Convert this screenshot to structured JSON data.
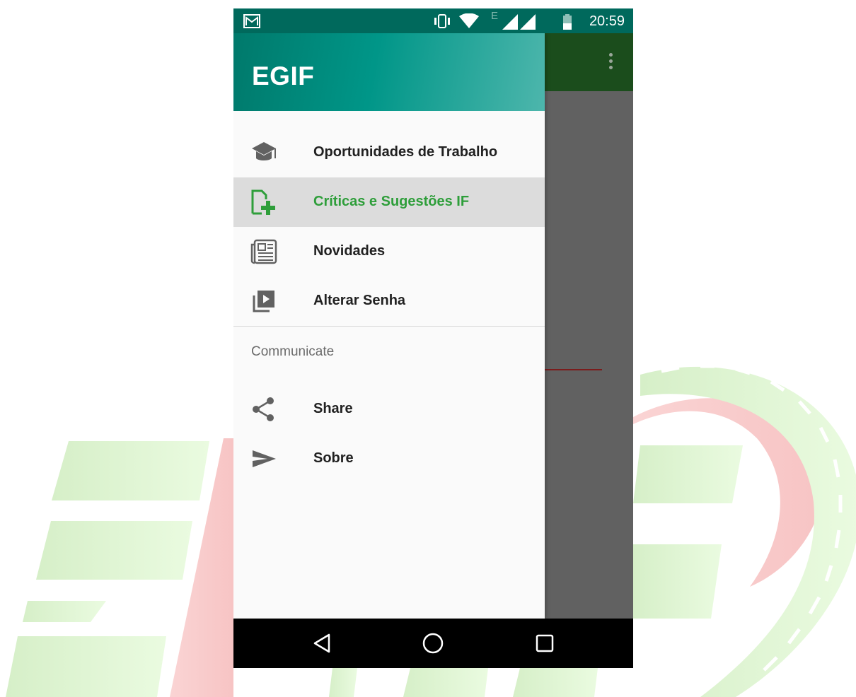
{
  "status_bar": {
    "time": "20:59",
    "network_label": "E",
    "icons": [
      "gmail-icon",
      "vibrate-icon",
      "wifi-icon",
      "signal-icon",
      "signal-icon",
      "battery-icon"
    ]
  },
  "drawer": {
    "title": "EGIF",
    "items": [
      {
        "label": "Oportunidades de Trabalho",
        "icon": "graduation-cap-icon",
        "selected": false
      },
      {
        "label": "Críticas e Sugestões IF",
        "icon": "note-add-icon",
        "selected": true
      },
      {
        "label": "Novidades",
        "icon": "newspaper-icon",
        "selected": false
      },
      {
        "label": "Alterar Senha",
        "icon": "video-library-icon",
        "selected": false
      }
    ],
    "section_header": "Communicate",
    "communicate_items": [
      {
        "label": "Share",
        "icon": "share-icon"
      },
      {
        "label": "Sobre",
        "icon": "send-icon"
      }
    ]
  },
  "nav_bar": {
    "buttons": [
      "back-icon",
      "home-icon",
      "recents-icon"
    ]
  },
  "colors": {
    "drawer_header_start": "#00796b",
    "drawer_header_end": "#4db6ac",
    "selected_text": "#2e9e3a",
    "app_bar": "#1b4d1c",
    "background_logo_green": "#d9f2c9",
    "background_logo_red": "#f7c9c9"
  }
}
